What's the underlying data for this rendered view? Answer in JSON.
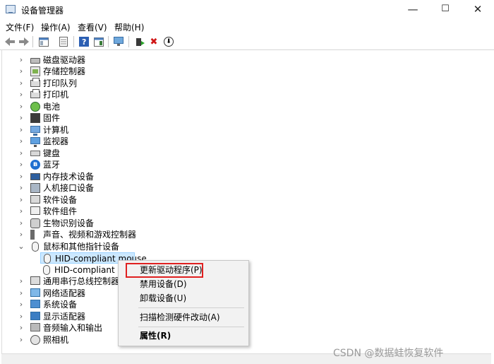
{
  "window": {
    "title": "设备管理器",
    "controls": {
      "minimize": "—",
      "maximize": "☐",
      "close": "✕"
    }
  },
  "menubar": [
    {
      "label": "文件(F)"
    },
    {
      "label": "操作(A)"
    },
    {
      "label": "查看(V)"
    },
    {
      "label": "帮助(H)"
    }
  ],
  "toolbar": {
    "icons": [
      "back-arrow-icon",
      "forward-arrow-icon",
      "show-hide-tree-icon",
      "properties-icon",
      "help-icon",
      "action-pane-icon",
      "scan-hardware-icon",
      "update-driver-icon",
      "uninstall-device-icon",
      "disable-device-icon"
    ],
    "delete_glyph": "✖",
    "down_glyph": "⬇"
  },
  "tree": [
    {
      "label": "磁盘驱动器",
      "icon": "disk",
      "expanded": false
    },
    {
      "label": "存储控制器",
      "icon": "storage",
      "expanded": false
    },
    {
      "label": "打印队列",
      "icon": "printer",
      "expanded": false
    },
    {
      "label": "打印机",
      "icon": "printer",
      "expanded": false
    },
    {
      "label": "电池",
      "icon": "battery",
      "expanded": false
    },
    {
      "label": "固件",
      "icon": "firmware",
      "expanded": false
    },
    {
      "label": "计算机",
      "icon": "computer",
      "expanded": false
    },
    {
      "label": "监视器",
      "icon": "monitor",
      "expanded": false
    },
    {
      "label": "键盘",
      "icon": "keyboard",
      "expanded": false
    },
    {
      "label": "蓝牙",
      "icon": "bluetooth",
      "expanded": false
    },
    {
      "label": "内存技术设备",
      "icon": "memory",
      "expanded": false
    },
    {
      "label": "人机接口设备",
      "icon": "hid",
      "expanded": false
    },
    {
      "label": "软件设备",
      "icon": "swdev",
      "expanded": false
    },
    {
      "label": "软件组件",
      "icon": "swcomp",
      "expanded": false
    },
    {
      "label": "生物识别设备",
      "icon": "bio",
      "expanded": false
    },
    {
      "label": "声音、视频和游戏控制器",
      "icon": "audio",
      "expanded": false
    },
    {
      "label": "鼠标和其他指针设备",
      "icon": "mouse",
      "expanded": true
    },
    {
      "label": "HID-compliant mouse",
      "icon": "mouse",
      "child": true,
      "selected": true
    },
    {
      "label": "HID-compliant mo",
      "icon": "mouse",
      "child": true
    },
    {
      "label": "通用串行总线控制器",
      "icon": "usb",
      "expanded": false
    },
    {
      "label": "网络适配器",
      "icon": "network",
      "expanded": false
    },
    {
      "label": "系统设备",
      "icon": "system",
      "expanded": false
    },
    {
      "label": "显示适配器",
      "icon": "display",
      "expanded": false
    },
    {
      "label": "音频输入和输出",
      "icon": "audioio",
      "expanded": false
    },
    {
      "label": "照相机",
      "icon": "camera",
      "expanded": false
    }
  ],
  "context_menu": {
    "update_driver": "更新驱动程序(P)",
    "disable_device": "禁用设备(D)",
    "uninstall_device": "卸载设备(U)",
    "scan_hardware": "扫描检测硬件改动(A)",
    "properties": "属性(R)"
  },
  "watermark": "CSDN @数据蛙恢复软件",
  "colors": {
    "selection": "#cce8ff",
    "highlight_border": "#e02020",
    "bluetooth": "#1e6fd0"
  }
}
